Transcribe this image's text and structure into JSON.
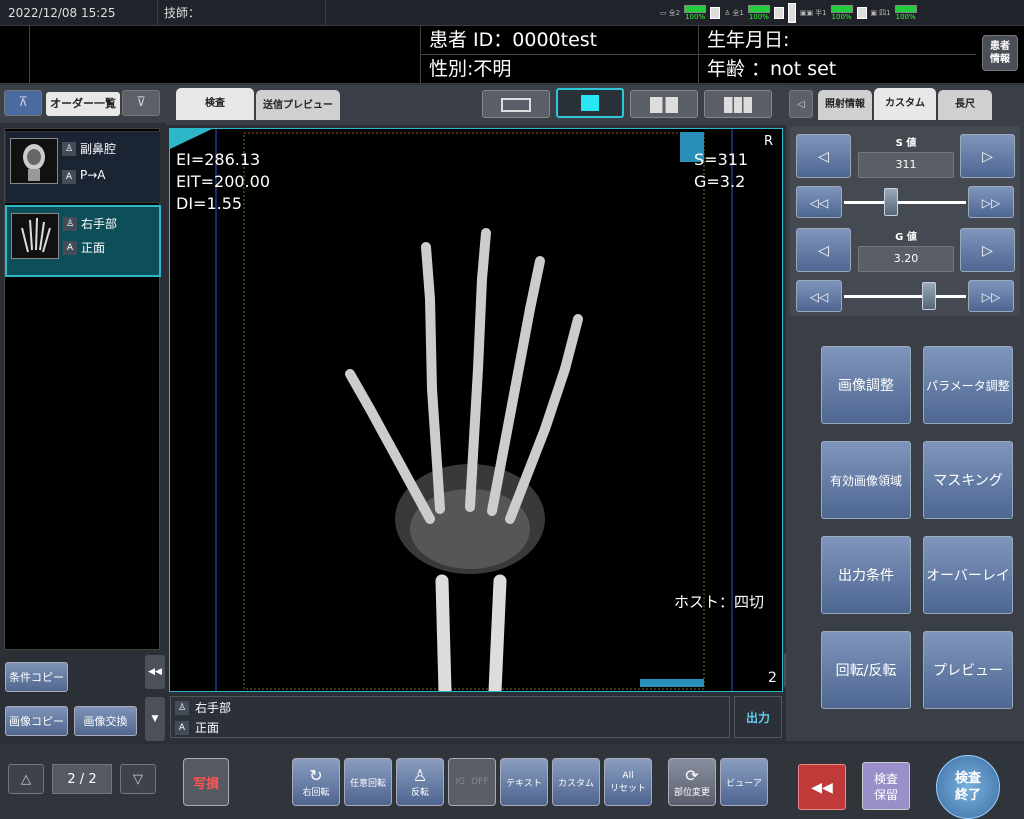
{
  "topbar": {
    "datetime": "2022/12/08 15:25",
    "technician": "技師：",
    "status": [
      {
        "label": "全2",
        "pct": "100%"
      },
      {
        "label": "全1",
        "pct": "100%"
      },
      {
        "label": "半1",
        "pct": "100%"
      },
      {
        "label": "四1",
        "pct": "100%"
      }
    ]
  },
  "patient": {
    "id": "患者 ID：0000test",
    "dob": "生年月日:",
    "sex": "性別:不明",
    "age": "年齢 ：not set",
    "info_button": "患者\n情報"
  },
  "left": {
    "order_list_tab": "オーダー一覧",
    "up_icon": "⊼",
    "down_icon": "⊽",
    "thumbnails": [
      {
        "part": "副鼻腔",
        "view": "P→A",
        "icon_a": "A"
      },
      {
        "part": "右手部",
        "view": "正面",
        "icon_a": "A"
      }
    ],
    "buttons": {
      "condition_copy": "条件コピー",
      "image_copy": "画像コピー",
      "image_swap": "画像交換"
    },
    "pager": "2 / 2"
  },
  "center": {
    "tab_exam": "検査",
    "tab_preview": "送信プレビュー",
    "overlay": {
      "ei": "EI=286.13",
      "eit": "EIT=200.00",
      "di": "DI=1.55",
      "s": "S=311",
      "g": "G=3.2",
      "host": "ホスト：四切",
      "index": "2",
      "marker": "R"
    },
    "caption": {
      "part": "右手部",
      "view": "正面",
      "output": "出力"
    },
    "toolbar": {
      "shot": "写損",
      "rotate_right": "右回転",
      "free_rotate": "任意回転",
      "flip": "反転",
      "ig": "IG",
      "ig_off": "OFF",
      "text": "テキスト",
      "custom": "カスタム",
      "all_reset": "All\nリセット",
      "part_change": "部位変更",
      "viewer": "ビューア"
    }
  },
  "right": {
    "tabs": {
      "back": "◁",
      "irradiation": "照射情報",
      "custom": "カスタム",
      "length": "長尺"
    },
    "s_label": "S 値",
    "s_value": "311",
    "g_label": "G 値",
    "g_value": "3.20",
    "buttons": [
      "画像調整",
      "パラメータ調整",
      "有効画像領域",
      "マスキング",
      "出力条件",
      "オーバーレイ",
      "回転/反転",
      "プレビュー"
    ],
    "bottom": {
      "rewind": "◀◀",
      "hold": "検査\n保留",
      "finish": "検査\n終了"
    }
  }
}
